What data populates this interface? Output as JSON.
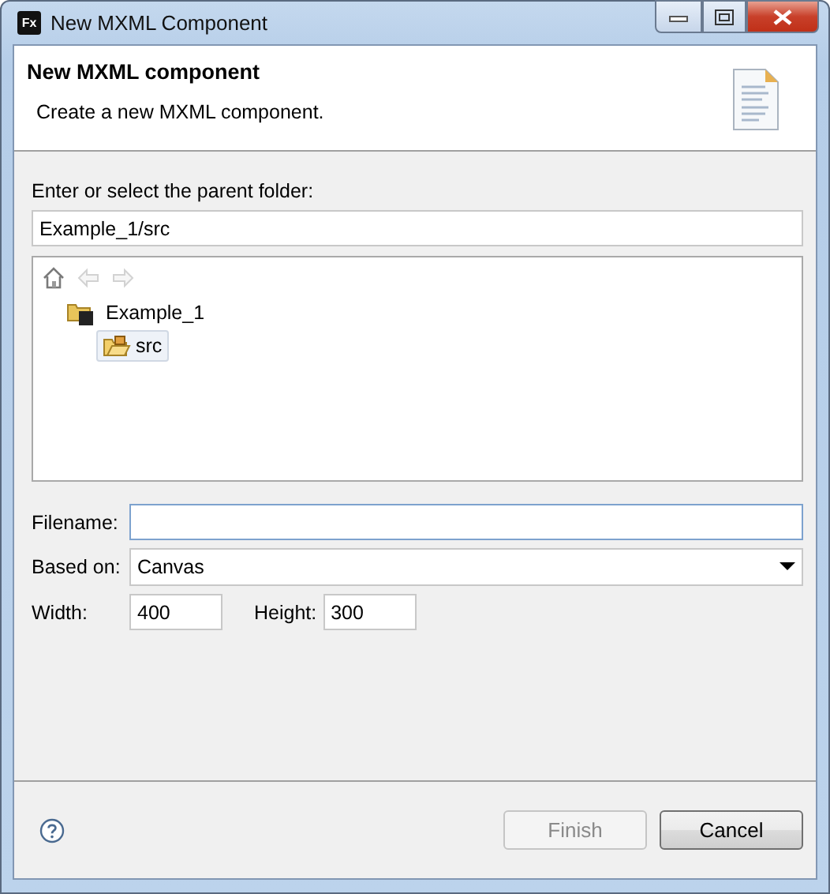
{
  "window": {
    "title": "New MXML Component",
    "icon_label": "Fx"
  },
  "header": {
    "title": "New MXML component",
    "description": "Create a new MXML component."
  },
  "parent_folder": {
    "label": "Enter or select the parent folder:",
    "value": "Example_1/src"
  },
  "tree": {
    "nav": [
      {
        "kind": "home",
        "disabled": false
      },
      {
        "kind": "back",
        "disabled": true
      },
      {
        "kind": "forward",
        "disabled": true
      }
    ],
    "items": [
      {
        "label": "Example_1",
        "kind": "project",
        "selected": false,
        "children": [
          {
            "label": "src",
            "kind": "folder",
            "selected": true
          }
        ]
      }
    ]
  },
  "filename": {
    "label": "Filename:",
    "focused": true
  },
  "based_on": {
    "label": "Based on:",
    "value": "Canvas"
  },
  "width": {
    "label": "Width:",
    "value": "400"
  },
  "height": {
    "label": "Height:",
    "value": "300"
  },
  "buttons": [
    {
      "label": "Finish",
      "disabled": true
    },
    {
      "label": "Cancel",
      "disabled": false
    }
  ]
}
